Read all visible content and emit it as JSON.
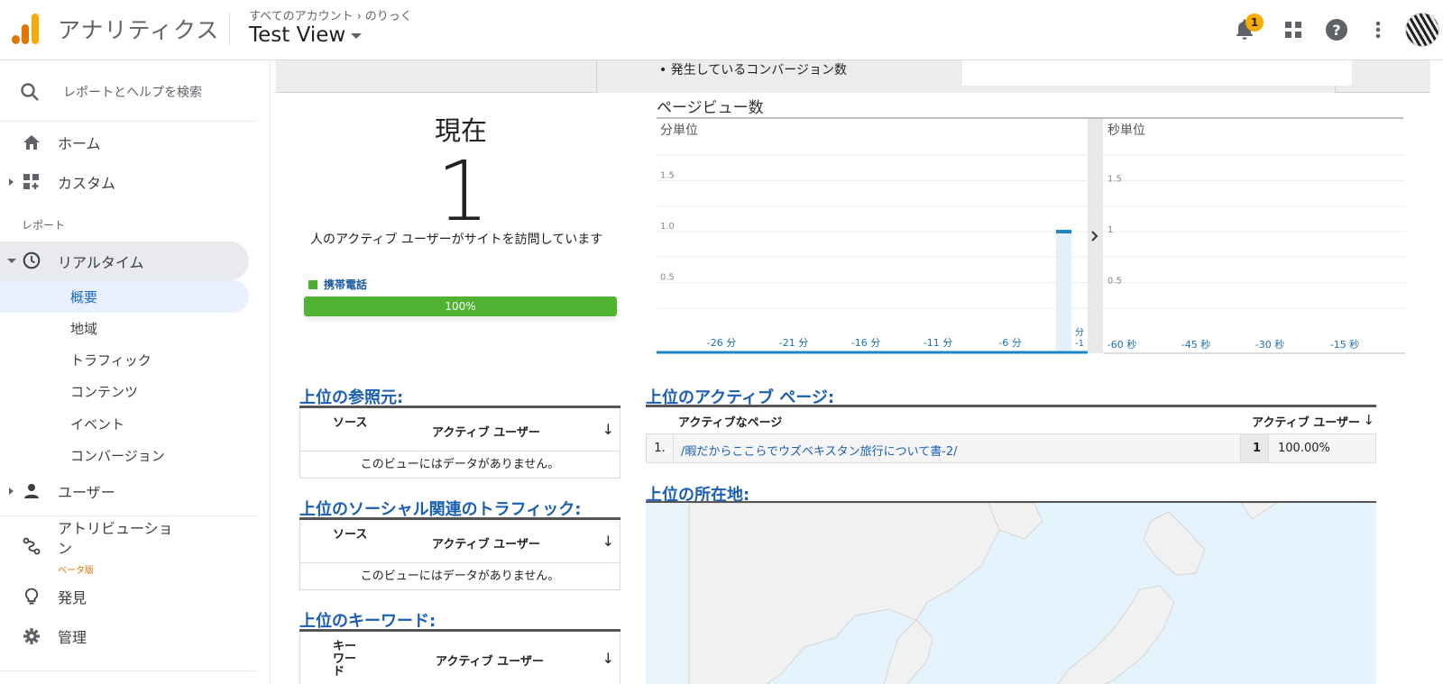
{
  "header": {
    "app_name": "アナリティクス",
    "breadcrumb_all": "すべてのアカウント",
    "breadcrumb_sep": "›",
    "breadcrumb_account": "のりっく",
    "view_name": "Test View",
    "notification_count": "1",
    "logo_colors": [
      "#f9ab00",
      "#e37400",
      "#e37400"
    ]
  },
  "sidebar": {
    "search_placeholder": "レポートとヘルプを検索",
    "home": "ホーム",
    "custom": "カスタム",
    "section_reports": "レポート",
    "realtime": "リアルタイム",
    "realtime_items": [
      "概要",
      "地域",
      "トラフィック",
      "コンテンツ",
      "イベント",
      "コンバージョン"
    ],
    "users": "ユーザー",
    "attribution_line1": "アトリビューショ",
    "attribution_line2": "ン",
    "attribution_beta": "ベータ版",
    "discover": "発見",
    "admin": "管理"
  },
  "main": {
    "conversions_bullet": "発生しているコンバージョン数",
    "now_label": "現在",
    "active_users": "1",
    "active_desc": "人のアクティブ ユーザーがサイトを訪問しています",
    "device_label": "携帯電話",
    "device_percent": "100%",
    "pageviews_title": "ページビュー数",
    "per_minute": "分単位",
    "per_second": "秒単位",
    "referrals_title": "上位の参照元:",
    "social_title": "上位のソーシャル関連のトラフィック:",
    "keywords_title": "上位のキーワード:",
    "col_source": "ソース",
    "col_keyword": "キーワード",
    "col_active_users": "アクティブ ユーザー",
    "no_data": "このビューにはデータがありません。",
    "active_pages_title": "上位のアクティブ ページ:",
    "col_active_page": "アクティブなページ",
    "page_rows": [
      {
        "idx": "1.",
        "page": "/暇だからここらでウズベキスタン旅行について書-2/",
        "count": "1",
        "pct": "100.00%"
      }
    ],
    "locations_title": "上位の所在地:"
  },
  "chart_data": [
    {
      "type": "bar",
      "title": "分単位",
      "x_tick_labels": [
        "-26 分",
        "-21 分",
        "-16 分",
        "-11 分",
        "-6 分",
        "分 -1"
      ],
      "y_tick_labels": [
        "0.5",
        "1.0",
        "1.5"
      ],
      "ylim": [
        0,
        2
      ],
      "x": [
        -1
      ],
      "values": [
        1
      ],
      "bar_color": "#1a86c8"
    },
    {
      "type": "bar",
      "title": "秒単位",
      "x_tick_labels": [
        "-60 秒",
        "-45 秒",
        "-30 秒",
        "-15 秒"
      ],
      "y_tick_labels": [
        "0.5",
        "1",
        "1.5"
      ],
      "ylim": [
        0,
        2
      ],
      "values": []
    }
  ]
}
